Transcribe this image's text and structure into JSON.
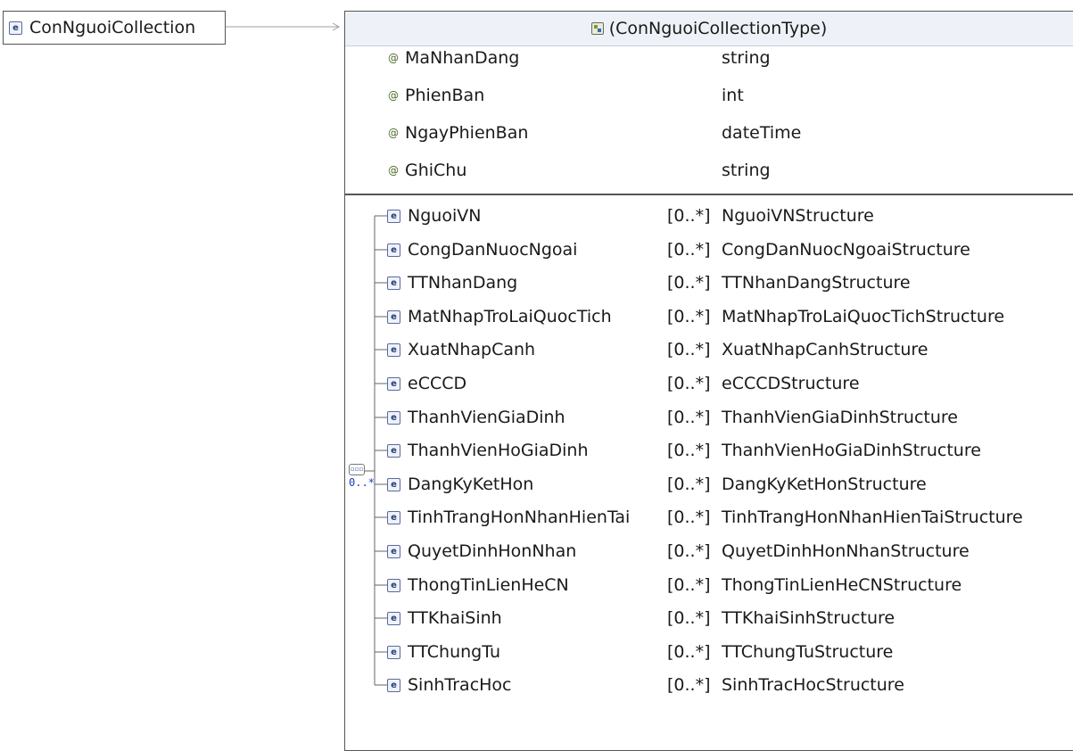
{
  "root": {
    "label": "ConNguoiCollection",
    "icon": "element-icon"
  },
  "type_box": {
    "title": "(ConNguoiCollectionType)",
    "icon": "complex-type-icon",
    "attributes": [
      {
        "name": "MaNhanDang",
        "type": "string"
      },
      {
        "name": "PhienBan",
        "type": "int"
      },
      {
        "name": "NgayPhienBan",
        "type": "dateTime"
      },
      {
        "name": "GhiChu",
        "type": "string"
      }
    ],
    "sequence": {
      "icon": "sequence-icon",
      "multiplicity": "0..*"
    },
    "elements": [
      {
        "name": "NguoiVN",
        "mult": "[0..*]",
        "type": "NguoiVNStructure"
      },
      {
        "name": "CongDanNuocNgoai",
        "mult": "[0..*]",
        "type": "CongDanNuocNgoaiStructure"
      },
      {
        "name": "TTNhanDang",
        "mult": "[0..*]",
        "type": "TTNhanDangStructure"
      },
      {
        "name": "MatNhapTroLaiQuocTich",
        "mult": "[0..*]",
        "type": "MatNhapTroLaiQuocTichStructure"
      },
      {
        "name": "XuatNhapCanh",
        "mult": "[0..*]",
        "type": "XuatNhapCanhStructure"
      },
      {
        "name": "eCCCD",
        "mult": "[0..*]",
        "type": "eCCCDStructure"
      },
      {
        "name": "ThanhVienGiaDinh",
        "mult": "[0..*]",
        "type": "ThanhVienGiaDinhStructure"
      },
      {
        "name": "ThanhVienHoGiaDinh",
        "mult": "[0..*]",
        "type": "ThanhVienHoGiaDinhStructure"
      },
      {
        "name": "DangKyKetHon",
        "mult": "[0..*]",
        "type": "DangKyKetHonStructure"
      },
      {
        "name": "TinhTrangHonNhanHienTai",
        "mult": "[0..*]",
        "type": "TinhTrangHonNhanHienTaiStructure"
      },
      {
        "name": "QuyetDinhHonNhan",
        "mult": "[0..*]",
        "type": "QuyetDinhHonNhanStructure"
      },
      {
        "name": "ThongTinLienHeCN",
        "mult": "[0..*]",
        "type": "ThongTinLienHeCNStructure"
      },
      {
        "name": "TTKhaiSinh",
        "mult": "[0..*]",
        "type": "TTKhaiSinhStructure"
      },
      {
        "name": "TTChungTu",
        "mult": "[0..*]",
        "type": "TTChungTuStructure"
      },
      {
        "name": "SinhTracHoc",
        "mult": "[0..*]",
        "type": "SinhTracHocStructure"
      }
    ]
  },
  "colors": {
    "header_bg": "#eef2f8",
    "border": "#555555",
    "multiplicity_blue": "#1a3fc0"
  }
}
